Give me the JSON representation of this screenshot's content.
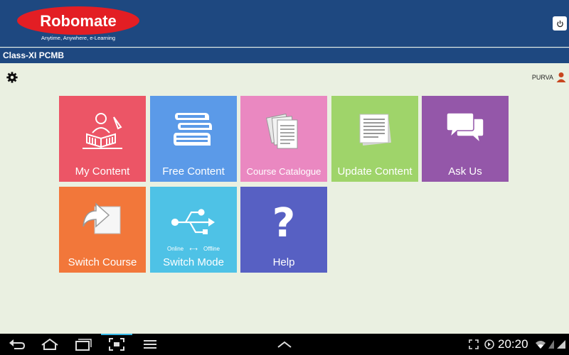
{
  "header": {
    "logo_text": "Robomate",
    "tagline": "Anytime, Anywhere, e-Learning",
    "power_icon": "power-icon"
  },
  "class_bar": {
    "title": "Class-XI PCMB"
  },
  "user": {
    "name": "PURVA",
    "icon": "user-icon"
  },
  "settings_icon": "gear-icon",
  "tiles": [
    {
      "label": "My Content",
      "color": "#ec5566",
      "icon": "reader-icon"
    },
    {
      "label": "Free Content",
      "color": "#5b9ae8",
      "icon": "books-icon"
    },
    {
      "label": "Course Catalogue",
      "color": "#ea88c1",
      "icon": "documents-icon"
    },
    {
      "label": "Update Content",
      "color": "#9fd46a",
      "icon": "document-icon"
    },
    {
      "label": "Ask Us",
      "color": "#9457a9",
      "icon": "chat-icon"
    },
    {
      "label": "Switch Course",
      "color": "#f2773a",
      "icon": "switch-arrow-icon"
    },
    {
      "label": "Switch Mode",
      "color": "#4ec2e6",
      "icon": "usb-icon",
      "mode_left": "Online",
      "mode_right": "Offline"
    },
    {
      "label": "Help",
      "color": "#5760c3",
      "icon": "question-icon"
    }
  ],
  "status_bar": {
    "time": "20:20"
  }
}
